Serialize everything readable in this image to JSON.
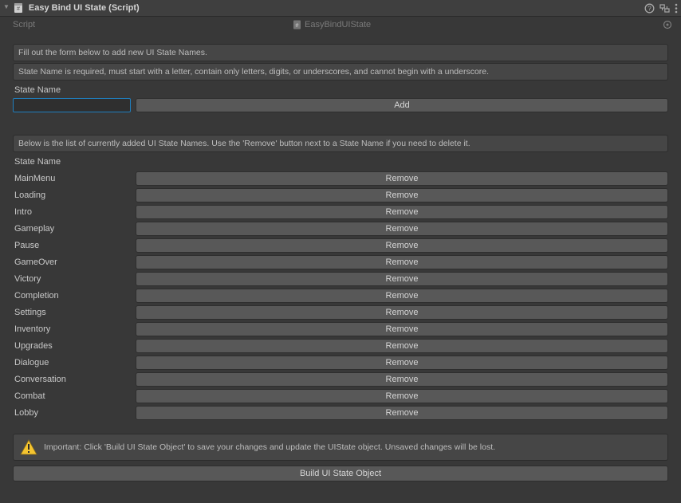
{
  "header": {
    "title": "Easy Bind UI State (Script)"
  },
  "scriptRow": {
    "label": "Script",
    "value": "EasyBindUIState"
  },
  "help1": "Fill out the form below to add new UI State Names.",
  "help2": "State Name is required, must start with a letter, contain only letters, digits, or underscores, and cannot begin with a underscore.",
  "stateNameLabel": "State Name",
  "addButton": "Add",
  "listHelp": "Below is the list of currently added UI State Names. Use the 'Remove' button next to a State Name if you need to delete it.",
  "listHeader": "State Name",
  "removeLabel": "Remove",
  "states": [
    "MainMenu",
    "Loading",
    "Intro",
    "Gameplay",
    "Pause",
    "GameOver",
    "Victory",
    "Completion",
    "Settings",
    "Inventory",
    "Upgrades",
    "Dialogue",
    "Conversation",
    "Combat",
    "Lobby"
  ],
  "warningText": "Important: Click 'Build UI State Object' to save your changes and update the UIState object. Unsaved changes will be lost.",
  "buildButton": "Build UI State Object"
}
